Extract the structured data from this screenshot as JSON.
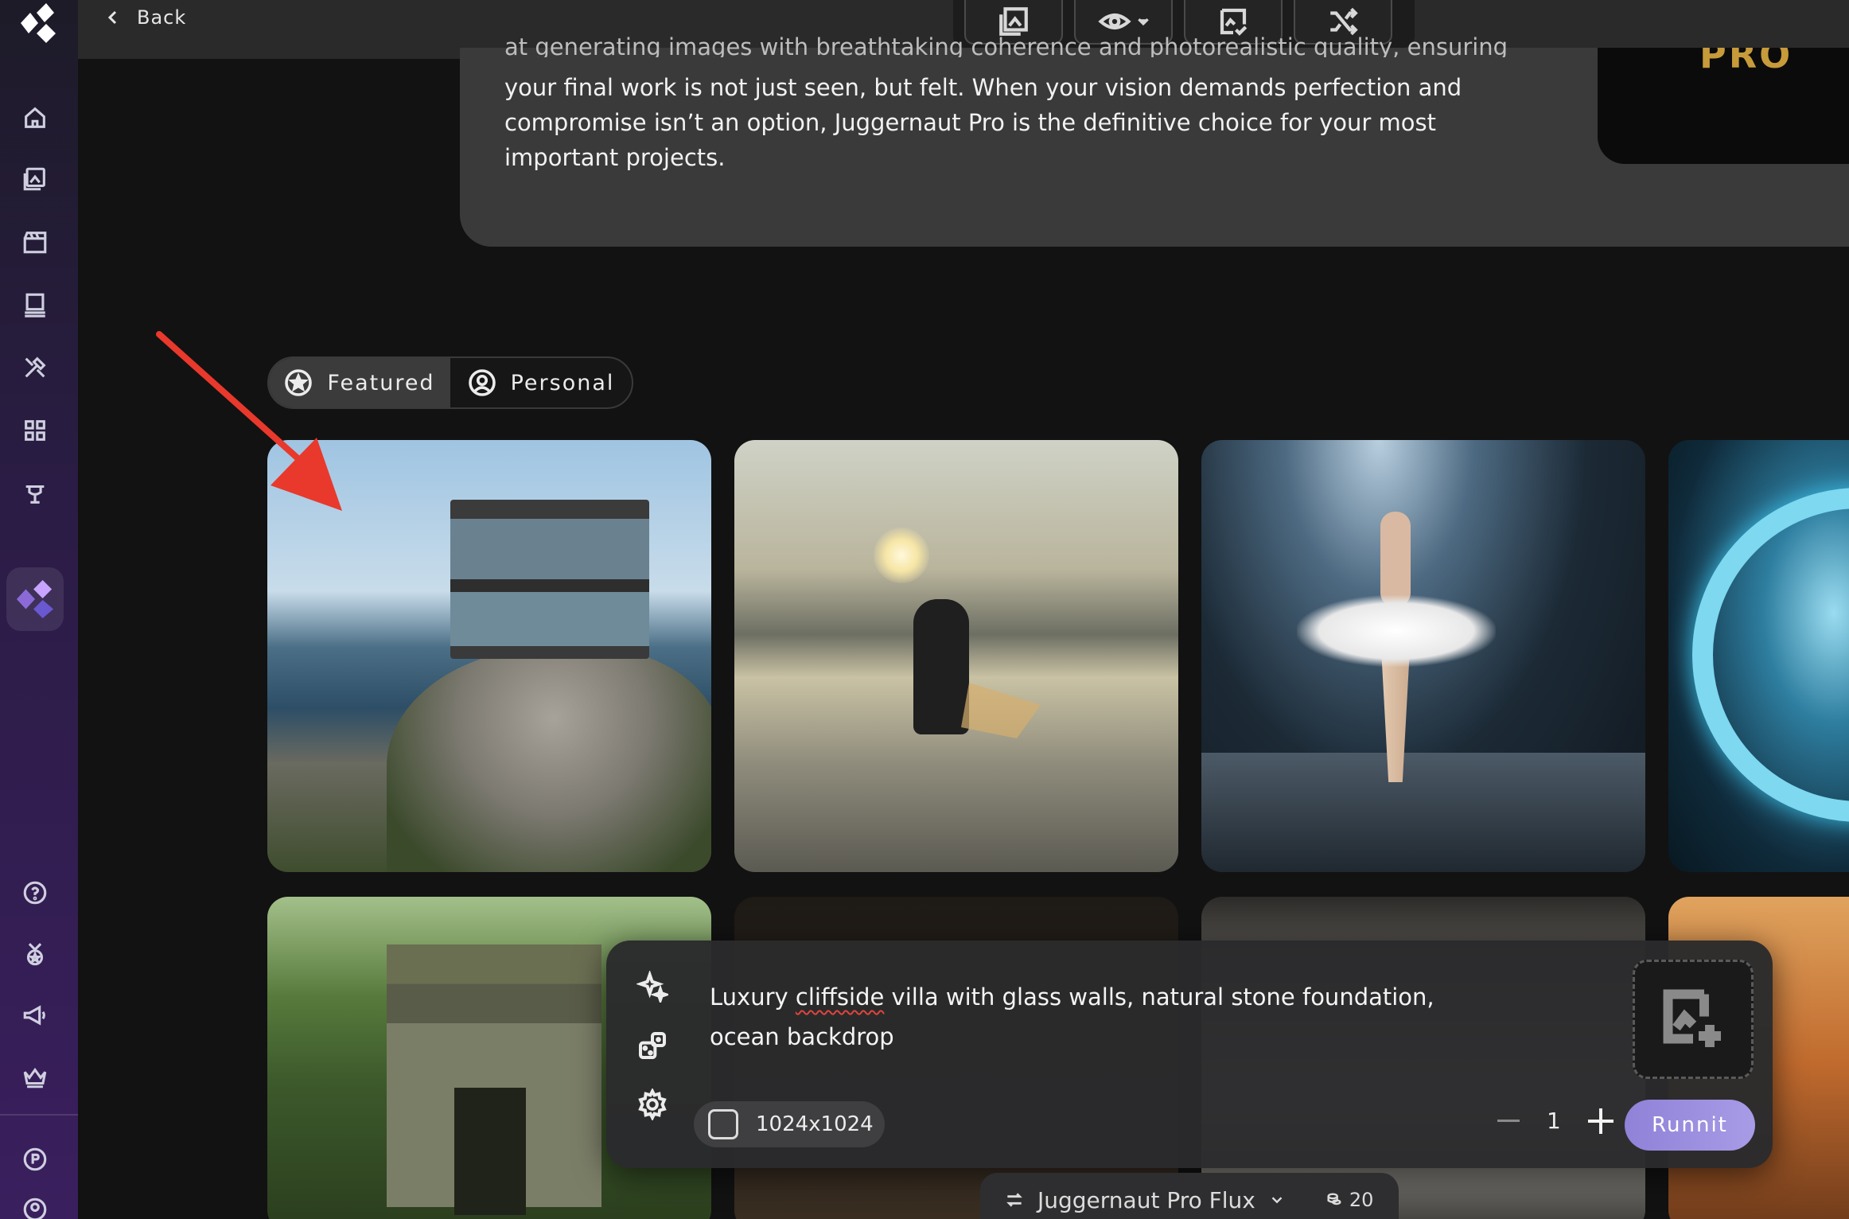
{
  "topbar": {
    "back_label": "Back",
    "tools": [
      "gallery-icon",
      "eye-icon",
      "verify-image-icon",
      "shuffle-icon"
    ]
  },
  "sidebar": {
    "items": [
      "home-icon",
      "images-icon",
      "video-icon",
      "layers-icon",
      "tools-icon",
      "apps-icon",
      "trophy-icon",
      "brand-icon",
      "help-icon",
      "badge-icon",
      "megaphone-icon",
      "crown-icon",
      "profile-p-icon",
      "user-icon"
    ]
  },
  "description": {
    "cut_line": "at generating images with breathtaking coherence and photorealistic quality, ensuring",
    "paragraph": "your final work is not just seen, but felt. When your vision demands perfection and compromise isn’t an option, Juggernaut Pro is the definitive choice for your most important projects.",
    "thumb_text": "PRO"
  },
  "tabs": {
    "featured": "Featured",
    "personal": "Personal"
  },
  "prompt": {
    "text_before": "Luxury ",
    "text_misspelled": "cliffside",
    "text_after": " villa with glass walls, natural stone foundation, ocean backdrop",
    "size_label": "1024x1024",
    "quantity": "1",
    "run_label": "Runnit"
  },
  "model": {
    "name": "Juggernaut Pro Flux",
    "credits": "20"
  },
  "colors": {
    "accent": "#9b8ee0",
    "annotation_arrow": "#e8392c"
  }
}
